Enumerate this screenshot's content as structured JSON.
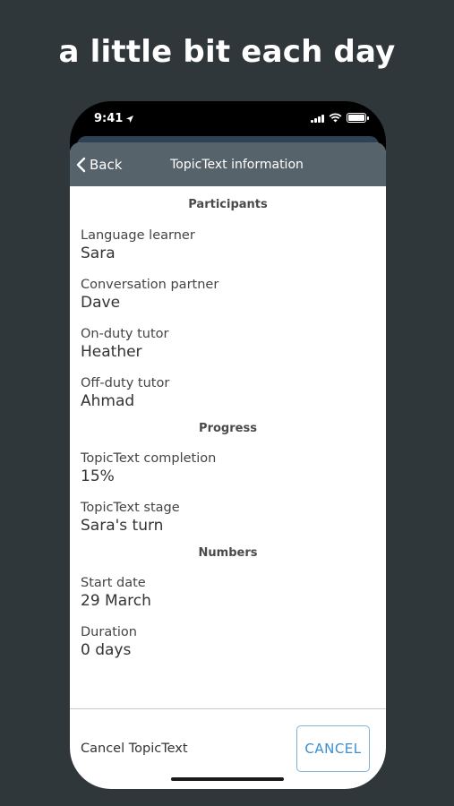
{
  "headline": "a little bit each day",
  "status_bar": {
    "time": "9:41"
  },
  "navbar": {
    "back_label": "Back",
    "title": "TopicText information"
  },
  "sections": {
    "participants": {
      "header": "Participants",
      "fields": [
        {
          "label": "Language learner",
          "value": "Sara"
        },
        {
          "label": "Conversation partner",
          "value": "Dave"
        },
        {
          "label": "On-duty tutor",
          "value": "Heather"
        },
        {
          "label": "Off-duty tutor",
          "value": "Ahmad"
        }
      ]
    },
    "progress": {
      "header": "Progress",
      "fields": [
        {
          "label": "TopicText completion",
          "value": "15%"
        },
        {
          "label": "TopicText stage",
          "value": "Sara's turn"
        }
      ]
    },
    "numbers": {
      "header": "Numbers",
      "fields": [
        {
          "label": "Start date",
          "value": "29 March"
        },
        {
          "label": "Duration",
          "value": "0 days"
        }
      ]
    }
  },
  "footer": {
    "label": "Cancel TopicText",
    "button_label": "CANCEL"
  },
  "icons": {
    "back": "chevron-left-icon",
    "location": "location-arrow-icon",
    "signal": "cellular-signal-icon",
    "wifi": "wifi-icon",
    "battery": "battery-icon"
  },
  "colors": {
    "background": "#2f373b",
    "navbar": "#56636b",
    "accent": "#3a8fd0"
  }
}
